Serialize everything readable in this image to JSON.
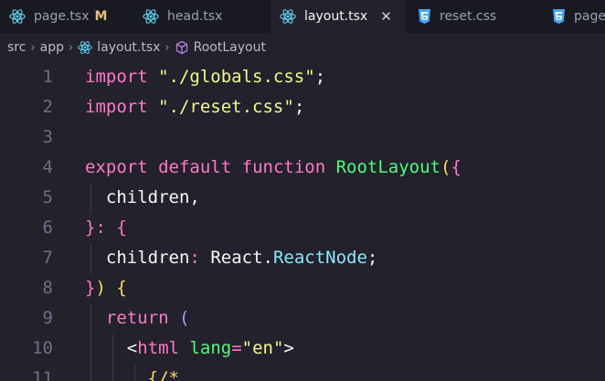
{
  "tabs": [
    {
      "label": "page.tsx",
      "icon": "react-icon",
      "modified": "M"
    },
    {
      "label": "head.tsx",
      "icon": "react-icon"
    },
    {
      "label": "layout.tsx",
      "icon": "react-icon",
      "active": true,
      "close": "✕"
    },
    {
      "label": "reset.css",
      "icon": "css3-icon"
    },
    {
      "label": "page.",
      "icon": "css3-icon"
    }
  ],
  "breadcrumb": {
    "parts": [
      "src",
      "app",
      "layout.tsx",
      "RootLayout"
    ],
    "separator": "›"
  },
  "editor": {
    "line_numbers": [
      "1",
      "2",
      "3",
      "4",
      "5",
      "6",
      "7",
      "8",
      "9",
      "10",
      "11"
    ],
    "tokens": {
      "import_kw": "import",
      "globals_str": "\"./globals.css\"",
      "reset_str": "\"./reset.css\"",
      "semicolon": ";",
      "export_kw": "export",
      "default_kw": "default",
      "function_kw": "function",
      "fn_name": "RootLayout",
      "paren_open": "(",
      "brace_open": "{",
      "children": "children",
      "comma": ",",
      "brace_close": "}",
      "colon": ":",
      "react_ns": "React",
      "dot": ".",
      "react_node": "ReactNode",
      "paren_close": ")",
      "return_kw": "return",
      "lt": "<",
      "html_tag": "html",
      "lang_attr": "lang",
      "eq": "=",
      "en_str": "\"en\"",
      "gt": ">",
      "line11_partial": "{/*"
    }
  },
  "colors": {
    "background": "#22212c",
    "tabbar": "#191a21",
    "pink": "#ff79c6",
    "purple": "#bd93f9",
    "yellow": "#f1fa8c",
    "green": "#50fa7b",
    "cyan": "#8be9fd"
  }
}
